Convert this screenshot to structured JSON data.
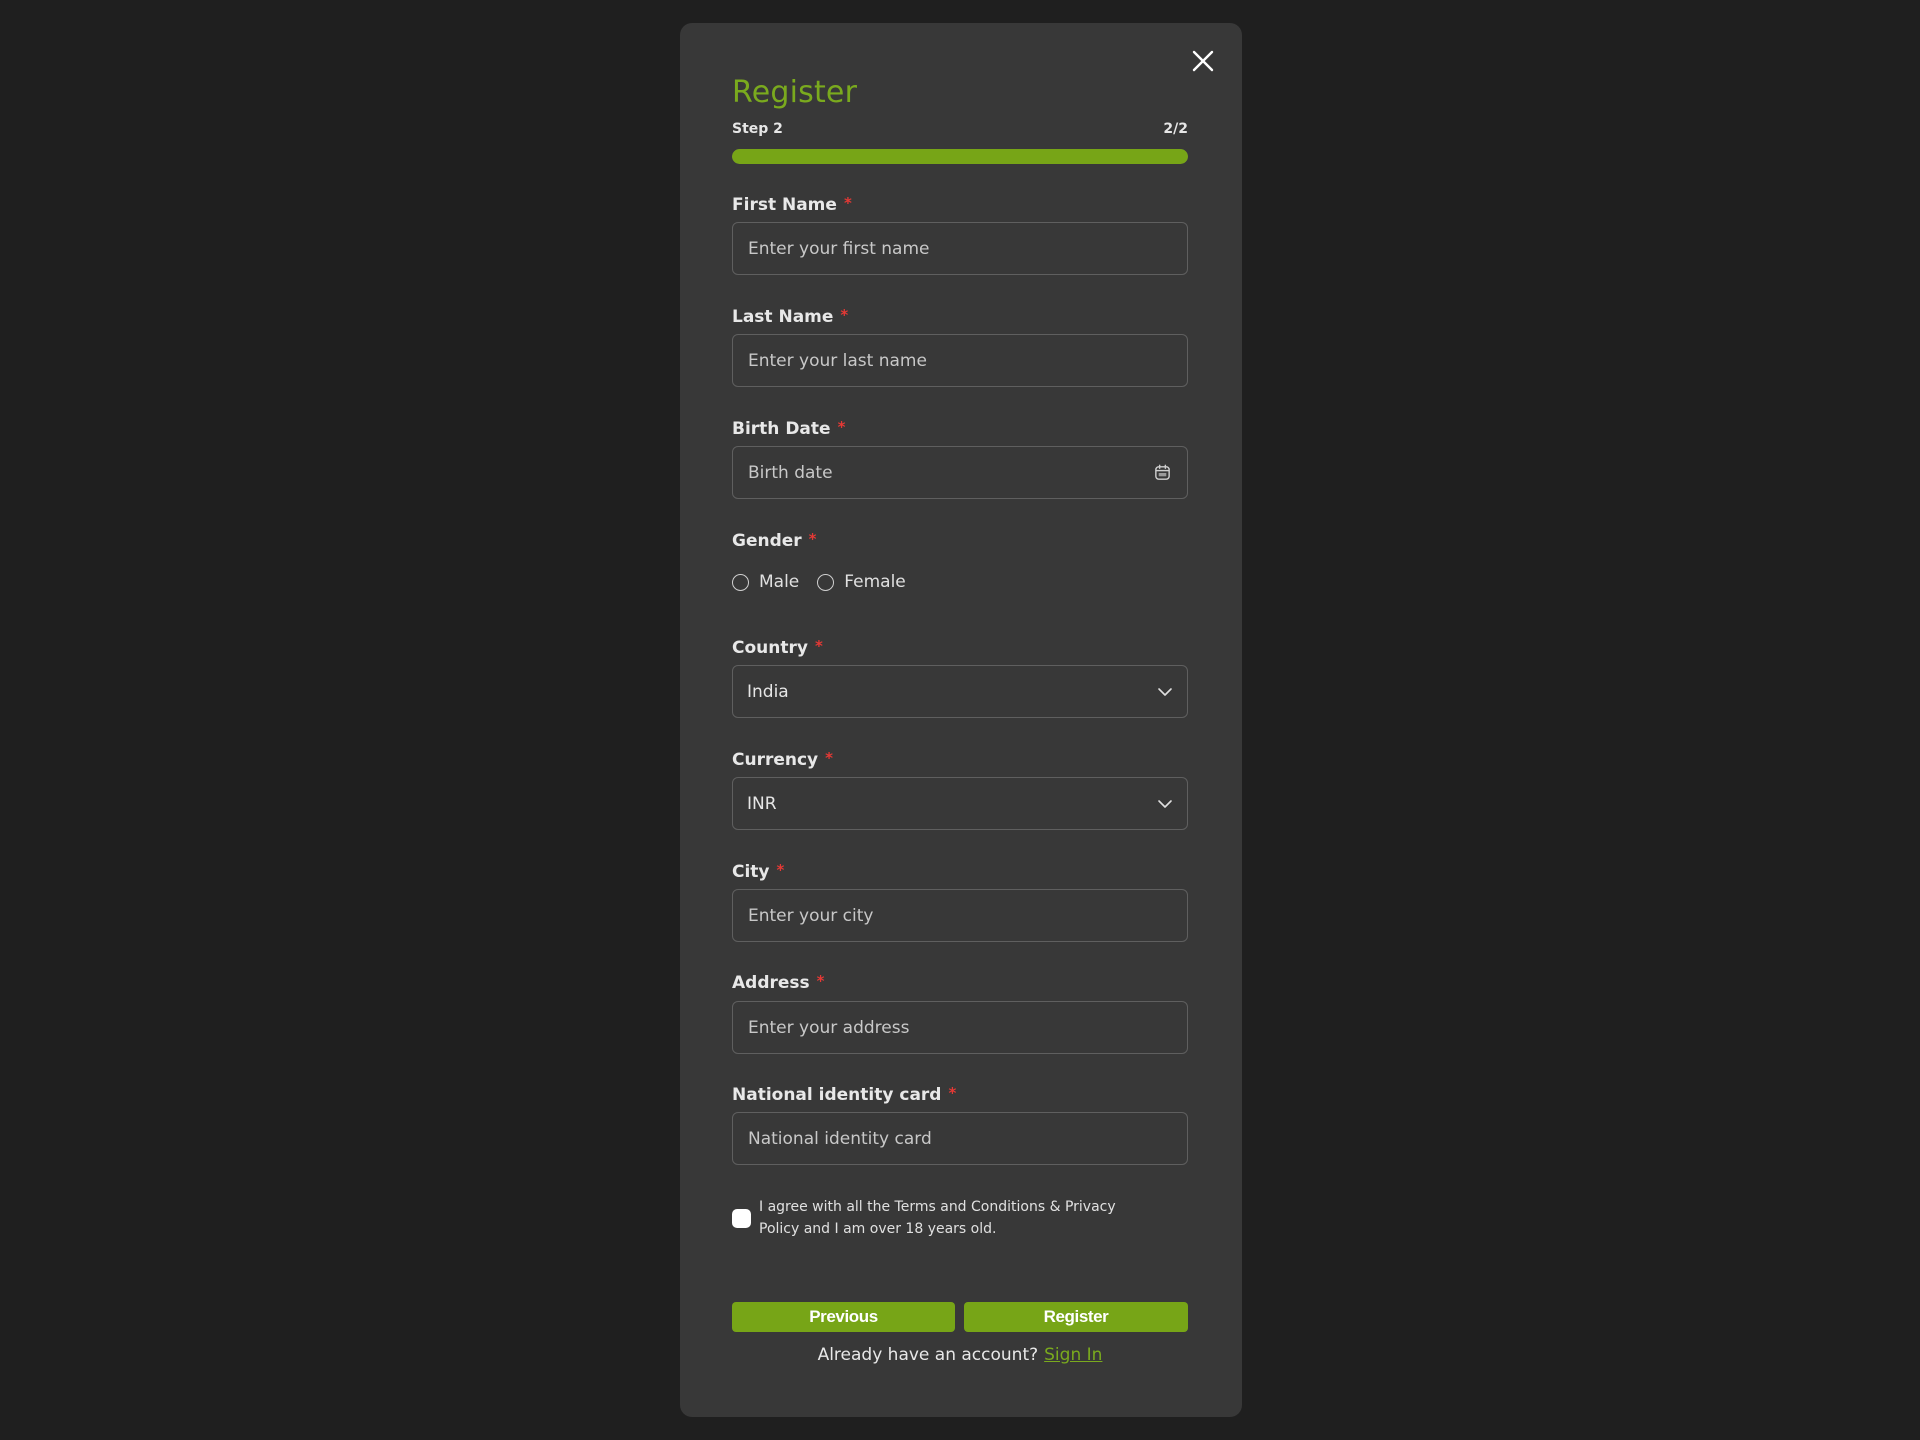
{
  "modal": {
    "title": "Register",
    "step_label": "Step 2",
    "step_count": "2/2",
    "progress_percent": 100,
    "accent_color": "#77a517",
    "close_icon": "close-icon"
  },
  "fields": {
    "first_name": {
      "label": "First Name",
      "required_mark": "*",
      "value": "",
      "placeholder": "Enter your first name"
    },
    "last_name": {
      "label": "Last Name",
      "required_mark": "*",
      "value": "",
      "placeholder": "Enter your last name"
    },
    "birth_date": {
      "label": "Birth Date",
      "required_mark": "*",
      "value": "",
      "placeholder": "Birth date",
      "icon": "calendar-icon"
    },
    "gender": {
      "label": "Gender",
      "required_mark": "*",
      "options": [
        "Male",
        "Female"
      ],
      "selected": null
    },
    "country": {
      "label": "Country",
      "required_mark": "*",
      "value": "India",
      "icon": "chevron-down-icon"
    },
    "currency": {
      "label": "Currency",
      "required_mark": "*",
      "value": "INR",
      "icon": "chevron-down-icon"
    },
    "city": {
      "label": "City",
      "required_mark": "*",
      "value": "",
      "placeholder": "Enter your city"
    },
    "address": {
      "label": "Address",
      "required_mark": "*",
      "value": "",
      "placeholder": "Enter your address"
    },
    "national_id": {
      "label": "National identity card",
      "required_mark": "*",
      "value": "",
      "placeholder": "National identity card"
    }
  },
  "agreement": {
    "checked": false,
    "text": "I agree with all the Terms and Conditions & Privacy Policy and I am over 18 years old."
  },
  "actions": {
    "previous_label": "Previous",
    "register_label": "Register"
  },
  "footer": {
    "prompt": "Already have an account?",
    "signin_label": "Sign In"
  }
}
